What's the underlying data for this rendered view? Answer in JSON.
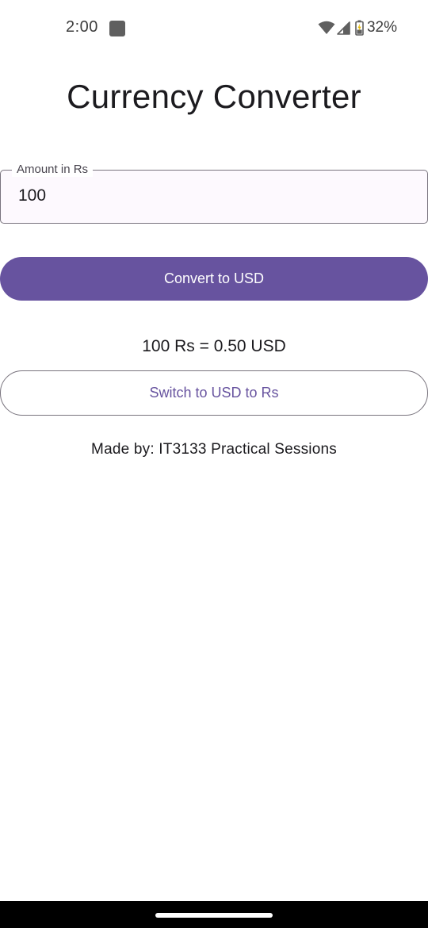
{
  "status_bar": {
    "time": "2:00",
    "battery_percent": "32%",
    "icons": [
      "app-notification-icon",
      "wifi-icon",
      "cellular-signal-icon",
      "battery-charging-icon"
    ]
  },
  "title": "Currency Converter",
  "amount_field": {
    "label": "Amount in Rs",
    "value": "100"
  },
  "convert_button": {
    "label": "Convert to USD"
  },
  "result": "100 Rs = 0.50 USD",
  "switch_button": {
    "label": "Switch to USD to Rs"
  },
  "credit": "Made by: IT3133 Practical Sessions",
  "colors": {
    "primary": "#67539f",
    "field_background": "#fdf9fe",
    "outline": "#79747e",
    "text": "#1c1b1f"
  }
}
